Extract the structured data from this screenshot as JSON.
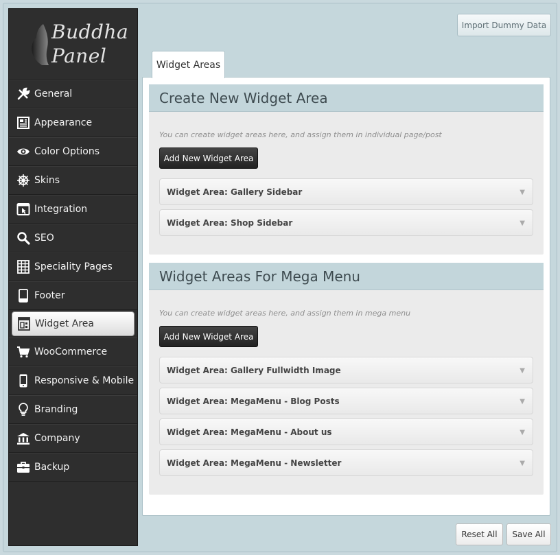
{
  "app": {
    "logo_line1": "Buddha",
    "logo_line2": "Panel"
  },
  "sidebar": {
    "items": [
      {
        "label": "General",
        "icon": "wrench-icon"
      },
      {
        "label": "Appearance",
        "icon": "layout-icon"
      },
      {
        "label": "Color Options",
        "icon": "eye-icon"
      },
      {
        "label": "Skins",
        "icon": "ship-wheel-icon"
      },
      {
        "label": "Integration",
        "icon": "window-cursor-icon"
      },
      {
        "label": "SEO",
        "icon": "search-icon"
      },
      {
        "label": "Speciality Pages",
        "icon": "grid-icon"
      },
      {
        "label": "Footer",
        "icon": "footer-icon"
      },
      {
        "label": "Widget Area",
        "icon": "widget-icon",
        "active": true
      },
      {
        "label": "WooCommerce",
        "icon": "cart-icon"
      },
      {
        "label": "Responsive & Mobile",
        "icon": "mobile-icon"
      },
      {
        "label": "Branding",
        "icon": "lightbulb-icon"
      },
      {
        "label": "Company",
        "icon": "bank-icon"
      },
      {
        "label": "Backup",
        "icon": "briefcase-icon"
      }
    ]
  },
  "header": {
    "import_label": "Import Dummy Data"
  },
  "tabs": [
    {
      "label": "Widget Areas"
    }
  ],
  "sections": [
    {
      "title": "Create New Widget Area",
      "hint": "You can create widget areas here, and assign them in individual page/post",
      "button": "Add New Widget Area",
      "items": [
        "Widget Area: Gallery Sidebar",
        "Widget Area: Shop Sidebar"
      ]
    },
    {
      "title": "Widget Areas For Mega Menu",
      "hint": "You can create widget areas here, and assign them in mega menu",
      "button": "Add New Widget Area",
      "items": [
        "Widget Area: Gallery Fullwidth Image",
        "Widget Area: MegaMenu - Blog Posts",
        "Widget Area: MegaMenu - About us",
        "Widget Area: MegaMenu - Newsletter"
      ]
    }
  ],
  "footer": {
    "reset_label": "Reset All",
    "save_label": "Save All"
  },
  "colors": {
    "sidebar_bg": "#2e2e2e",
    "frame_bg": "#c5d7dc",
    "section_head": "#c3d6db"
  }
}
